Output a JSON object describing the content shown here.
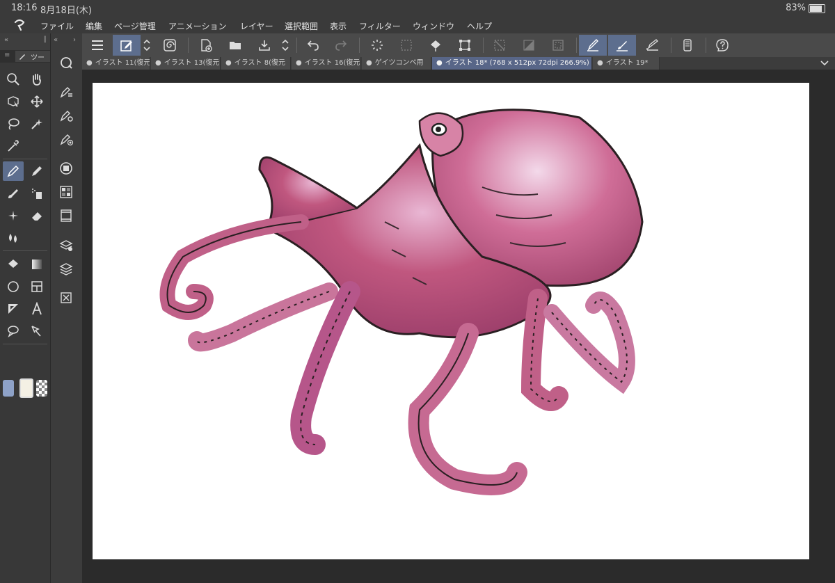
{
  "status_bar": {
    "time": "18:16",
    "date": "8月18日(木)",
    "battery": "83%",
    "battery_level": 0.83
  },
  "menu": {
    "items": [
      "ファイル",
      "編集",
      "ページ管理",
      "アニメーション",
      "レイヤー",
      "選択範囲",
      "表示",
      "フィルター",
      "ウィンドウ",
      "ヘルプ"
    ]
  },
  "toolbar": {
    "buttons": [
      "menu-icon",
      "edit-mode-icon",
      "up-down-icon",
      "spiral-icon",
      "new-page-icon",
      "open-folder-icon",
      "save-icon",
      "up-down-icon",
      "undo-icon",
      "redo-icon",
      "spinner-icon",
      "fill-dots-icon",
      "bucket-fill-icon",
      "transform-icon",
      "select-none-icon",
      "invert-icon",
      "select-border-icon",
      "pen-pressure-icon",
      "brush-pressure-icon",
      "ruler-pen-icon",
      "smartphone-icon",
      "help-icon"
    ]
  },
  "tabs": [
    {
      "label": "イラスト 11(復元"
    },
    {
      "label": "イラスト 13(復元"
    },
    {
      "label": "イラスト 8(復元"
    },
    {
      "label": "イラスト 16(復元"
    },
    {
      "label": "ゲイツコンペ用"
    },
    {
      "label": "イラスト 18* (768 x 512px 72dpi 266.9%)"
    },
    {
      "label": "イラスト 19*"
    }
  ],
  "tab_dot": "●",
  "left_panel": {
    "tab_label": "ツー",
    "tools": [
      "zoom-icon",
      "hand-icon",
      "object-icon",
      "move-icon",
      "lasso-icon",
      "magic-wand-icon",
      "eyedropper-icon",
      "pen-icon",
      "pencil-icon",
      "brush-icon",
      "airbrush-icon",
      "decoration-icon",
      "eraser-icon",
      "blend-icon",
      "fill-icon",
      "gradient-icon",
      "figure-icon",
      "frame-icon",
      "ruler-icon",
      "text-icon",
      "balloon-icon",
      "correct-line-icon"
    ],
    "colors": {
      "main": "#8ea2c8",
      "sub": "#f4f0e4"
    }
  },
  "sub_panel": {
    "tools": [
      "zoom-navigator-icon",
      "sub-tool-detail-icon",
      "tool-property-icon",
      "brush-size-icon",
      "color-circle-icon",
      "color-set-icon",
      "animation-icon",
      "layer-property-icon",
      "layer-icon",
      "material-icon"
    ]
  },
  "canvas": {
    "background": "#ffffff",
    "artwork": "octopus-illustration"
  }
}
